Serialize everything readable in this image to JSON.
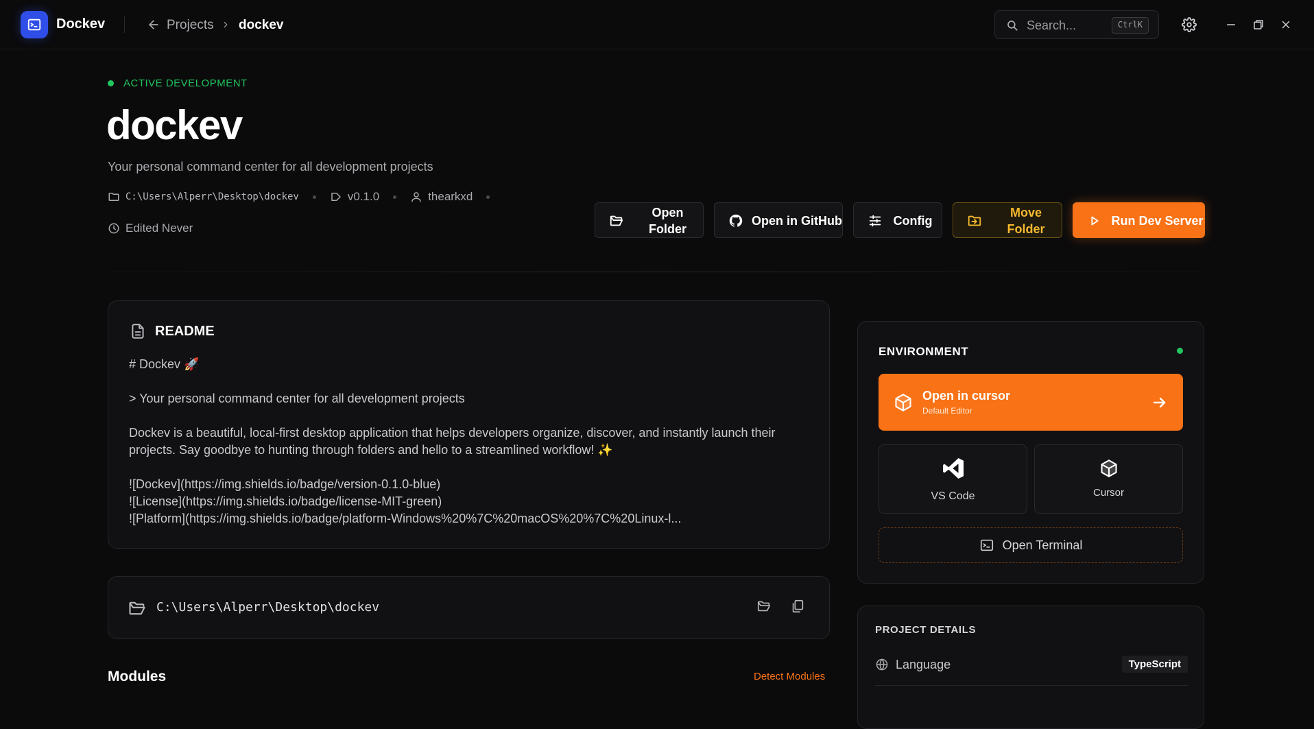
{
  "app": {
    "name": "Dockev"
  },
  "breadcrumb": {
    "parent": "Projects",
    "current": "dockev"
  },
  "search": {
    "placeholder": "Search...",
    "shortcut": "CtrlK"
  },
  "project": {
    "status": "ACTIVE DEVELOPMENT",
    "name": "dockev",
    "description": "Your personal command center for all development projects",
    "path": "C:\\Users\\Alperr\\Desktop\\dockev",
    "version": "v0.1.0",
    "author": "thearkxd",
    "edited": "Edited Never"
  },
  "actions": {
    "open_folder": "Open Folder",
    "open_github": "Open in GitHub",
    "config": "Config",
    "move_folder": "Move Folder",
    "run_dev": "Run Dev Server"
  },
  "readme": {
    "title": "README",
    "lines": [
      "# Dockev 🚀",
      "> Your personal command center for all development projects",
      "Dockev is a beautiful, local-first desktop application that helps developers organize, discover, and instantly launch their projects. Say goodbye to hunting through folders and hello to a streamlined workflow! ✨",
      "![Dockev](https://img.shields.io/badge/version-0.1.0-blue)",
      "![License](https://img.shields.io/badge/license-MIT-green)",
      "![Platform](https://img.shields.io/badge/platform-Windows%20%7C%20macOS%20%7C%20Linux-l..."
    ]
  },
  "path_card": {
    "path": "C:\\Users\\Alperr\\Desktop\\dockev"
  },
  "modules": {
    "title": "Modules",
    "detect": "Detect Modules"
  },
  "environment": {
    "title": "ENVIRONMENT",
    "primary": {
      "name": "Open in cursor",
      "sub": "Default Editor"
    },
    "editors": [
      "VS Code",
      "Cursor"
    ],
    "terminal": "Open Terminal"
  },
  "details": {
    "title": "PROJECT DETAILS",
    "rows": [
      {
        "key": "Language",
        "value": "TypeScript"
      }
    ]
  },
  "colors": {
    "accent": "#f97316",
    "brand": "#2f4ee8",
    "status": "#22c55e",
    "move": "#f5b82e"
  }
}
